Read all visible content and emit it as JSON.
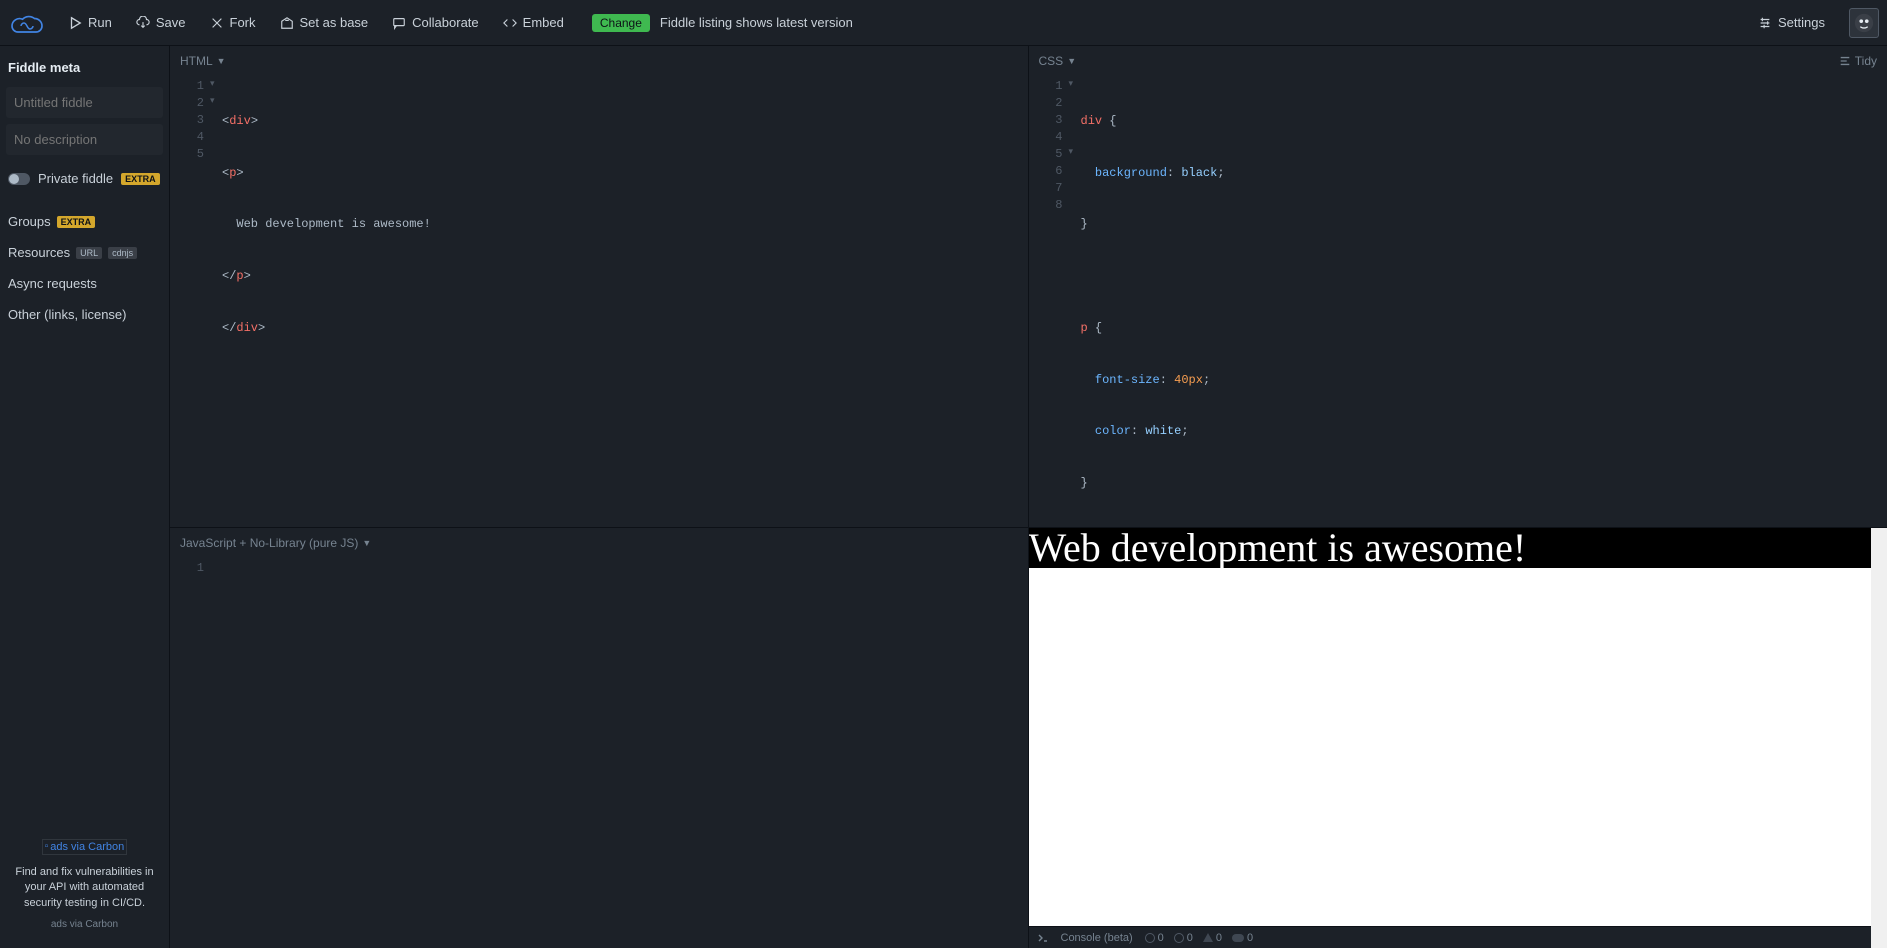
{
  "topbar": {
    "run": "Run",
    "save": "Save",
    "fork": "Fork",
    "set_as_base": "Set as base",
    "collaborate": "Collaborate",
    "embed": "Embed",
    "change_badge": "Change",
    "listing_text": "Fiddle listing shows latest version",
    "settings": "Settings"
  },
  "sidebar": {
    "meta_title": "Fiddle meta",
    "title_placeholder": "Untitled fiddle",
    "desc_placeholder": "No description",
    "private_label": "Private fiddle",
    "extra": "EXTRA",
    "groups": "Groups",
    "resources": "Resources",
    "url": "URL",
    "cdnjs": "cdnjs",
    "async": "Async requests",
    "other": "Other (links, license)",
    "ad_img_alt": "ads via Carbon",
    "ad_text": "Find and fix vulnerabilities in your API with automated security testing in CI/CD.",
    "ad_footer": "ads via Carbon"
  },
  "panes": {
    "html_label": "HTML",
    "css_label": "CSS",
    "js_label": "JavaScript + No-Library (pure JS)",
    "tidy": "Tidy"
  },
  "html_code": {
    "l1a": "<",
    "l1b": "div",
    "l1c": ">",
    "l2a": "<",
    "l2b": "p",
    "l2c": ">",
    "l3": "  Web development is awesome!",
    "l4a": "</",
    "l4b": "p",
    "l4c": ">",
    "l5a": "</",
    "l5b": "div",
    "l5c": ">",
    "ln": {
      "1": "1",
      "2": "2",
      "3": "3",
      "4": "4",
      "5": "5"
    },
    "fold": {
      "1": "▾",
      "2": "▾"
    }
  },
  "css_code": {
    "l1a": "div",
    "l1b": " {",
    "l2a": "  background",
    "l2b": ": ",
    "l2c": "black",
    "l2d": ";",
    "l3": "}",
    "l5a": "p",
    "l5b": " {",
    "l6a": "  font-size",
    "l6b": ": ",
    "l6c": "40px",
    "l6d": ";",
    "l7a": "  color",
    "l7b": ": ",
    "l7c": "white",
    "l7d": ";",
    "l8": "}",
    "ln": {
      "1": "1",
      "2": "2",
      "3": "3",
      "4": "4",
      "5": "5",
      "6": "6",
      "7": "7",
      "8": "8"
    },
    "fold": {
      "1": "▾",
      "5": "▾"
    }
  },
  "js_code": {
    "ln": {
      "1": "1"
    }
  },
  "result": {
    "text": "Web development is awesome!"
  },
  "console": {
    "label": "Console (beta)",
    "zero": "0"
  }
}
